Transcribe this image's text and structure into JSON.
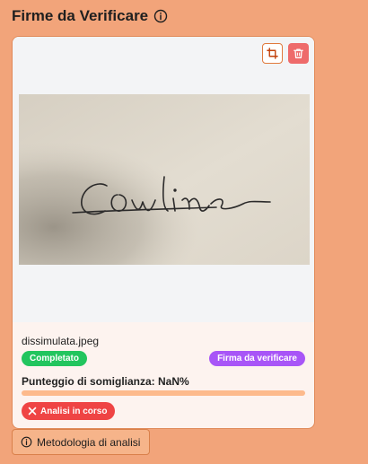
{
  "header": {
    "title": "Firme da Verificare",
    "info_icon": "info-circle-icon"
  },
  "card": {
    "toolbar": {
      "crop_icon": "crop-icon",
      "delete_icon": "trash-icon"
    },
    "file_name": "dissimulata.jpeg",
    "status_badge": "Completato",
    "type_badge": "Firma da verificare",
    "score_label": "Punteggio di somiglianza: NaN%",
    "score_value": null,
    "analysis_button": "Analisi in corso",
    "analysis_icon": "x-icon"
  },
  "footer": {
    "method_button": "Metodologia di analisi",
    "method_icon": "info-circle-icon"
  },
  "colors": {
    "page_background": "#f2a47a",
    "card_background": "#fdf3ef",
    "status_green": "#22c55e",
    "type_purple": "#a855f7",
    "danger_red": "#ef4444",
    "progress_track": "#fdba8c"
  }
}
